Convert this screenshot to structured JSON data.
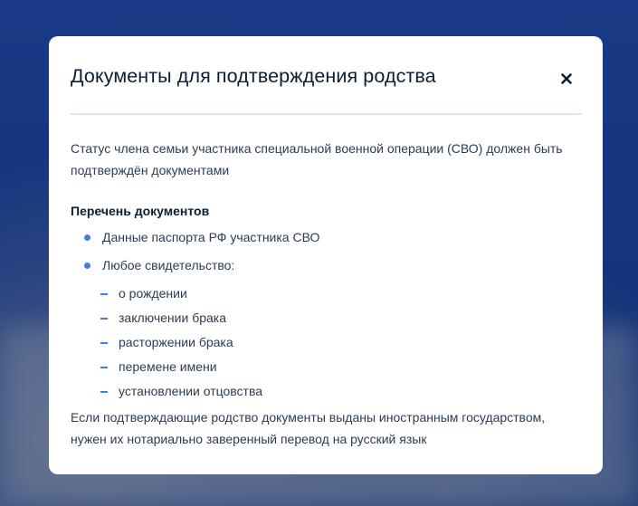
{
  "modal": {
    "title": "Документы для подтверждения родства",
    "close_icon": "close-icon",
    "intro": "Статус члена семьи участника специальной военной операции (СВО) должен быть подтверждён документами",
    "section_title": "Перечень документов",
    "bullets": [
      {
        "label": "Данные паспорта РФ участника СВО"
      },
      {
        "label": "Любое свидетельство:"
      }
    ],
    "certificate_types": [
      "о рождении",
      "заключении брака",
      "расторжении брака",
      "перемене имени",
      "установлении отцовства"
    ],
    "outro": "Если подтверждающие родство документы выданы иностранным государством, нужен их нотариально заверенный перевод на русский язык"
  },
  "colors": {
    "backdrop": "#173680",
    "accent": "#3d7ee8",
    "title_text": "#0b1f33",
    "body_text": "#2a3d52",
    "divider": "#dbe5f3"
  }
}
